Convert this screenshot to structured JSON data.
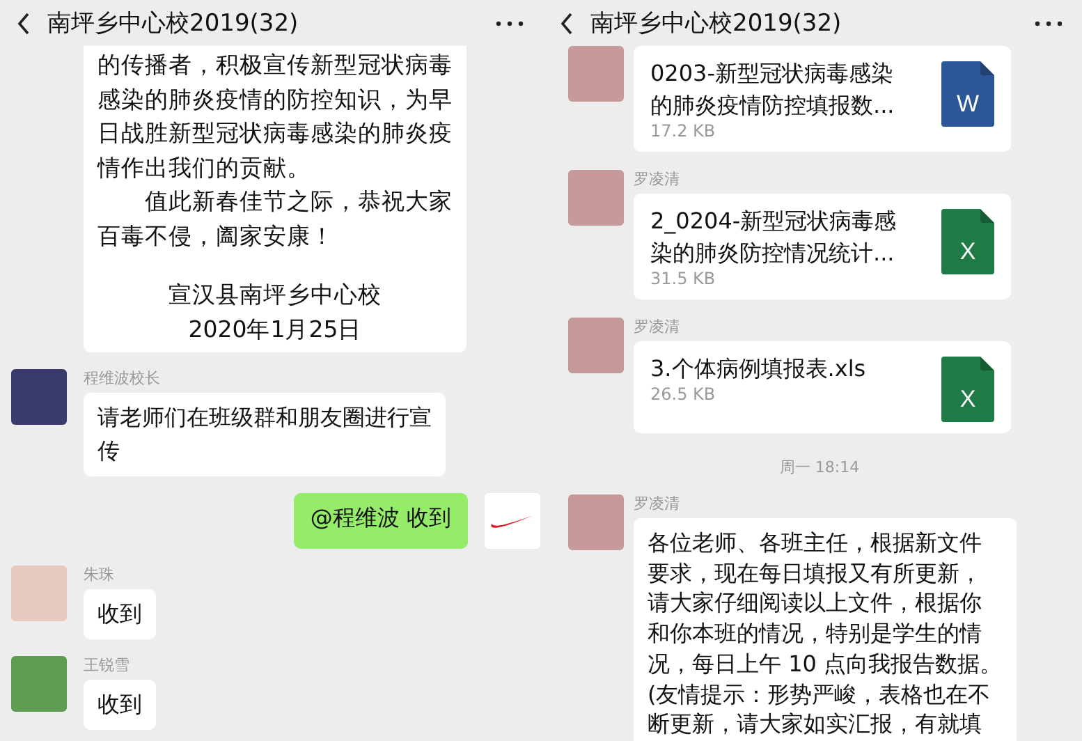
{
  "panels": [
    {
      "title": "南坪乡中心校2019(32)",
      "messages": [
        {
          "kind": "continued",
          "lines": [
            "的传播者，积极宣传新型冠状病毒",
            "感染的肺炎疫情的防控知识，为早",
            "日战胜新型冠状病毒感染的肺炎疫",
            "情作出我们的贡献。",
            "　　值此新春佳节之际，恭祝大家",
            "百毒不侵，阖家安康！"
          ],
          "signature": [
            "宣汉县南坪乡中心校",
            "2020年1月25日"
          ]
        },
        {
          "kind": "text",
          "sender": "程维波校长",
          "lines": [
            "请老师们在班级群和朋友圈进行宣",
            "传"
          ]
        },
        {
          "kind": "sent",
          "lines": [
            "@程维波  收到"
          ]
        },
        {
          "kind": "text",
          "sender": "朱珠",
          "lines": [
            "收到"
          ]
        },
        {
          "kind": "text",
          "sender": "王锐雪",
          "lines": [
            "收到"
          ]
        }
      ]
    },
    {
      "title": "南坪乡中心校2019(32)",
      "messages": [
        {
          "kind": "file",
          "name_lines": [
            "0203-新型冠状病毒感染",
            "的肺炎疫情防控填报数..."
          ],
          "size": "17.2 KB",
          "color": "#2b5797",
          "icon_letter": "W"
        },
        {
          "kind": "file",
          "sender": "罗凌清",
          "name_lines": [
            "2_0204-新型冠状病毒感",
            "染的肺炎防控情况统计..."
          ],
          "size": "31.5 KB",
          "color": "#1e7b45",
          "icon_letter": "X"
        },
        {
          "kind": "file",
          "sender": "罗凌清",
          "name_lines": [
            "3.个体病例填报表.xls"
          ],
          "size": "26.5 KB",
          "color": "#1e7b45",
          "icon_letter": "X"
        },
        {
          "kind": "time",
          "text": "周一 18:14"
        },
        {
          "kind": "text",
          "sender": "罗凌清",
          "lines": [
            "各位老师、各班主任，根据新文件",
            "要求，现在每日填报又有所更新，",
            "请大家仔细阅读以上文件，根据你",
            "和你本班的情况，特别是学生的情",
            "况，每日上午 10 点向我报告数据。",
            "(友情提示：形势严峻，表格也在不",
            "断更新，请大家如实汇报，有就填"
          ]
        }
      ]
    }
  ]
}
